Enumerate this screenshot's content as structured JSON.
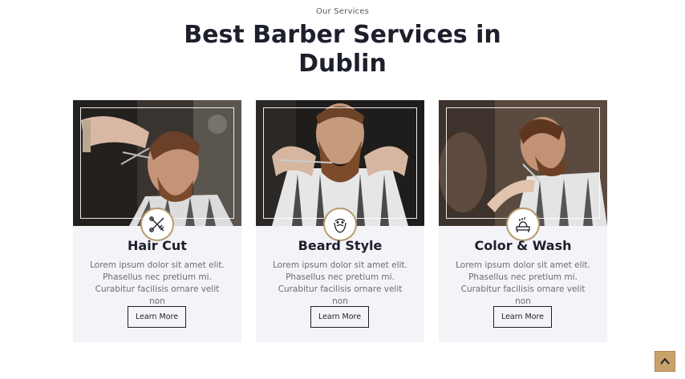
{
  "header": {
    "eyebrow": "Our Services",
    "title": "Best Barber Services in Dublin"
  },
  "services": [
    {
      "title": "Hair Cut",
      "description": "Lorem ipsum dolor sit amet elit. Phasellus nec pretium mi. Curabitur facilisis ornare velit non",
      "button_label": "Learn More",
      "icon": "scissors-comb-icon"
    },
    {
      "title": "Beard Style",
      "description": "Lorem ipsum dolor sit amet elit. Phasellus nec pretium mi. Curabitur facilisis ornare velit non",
      "button_label": "Learn More",
      "icon": "beard-face-icon"
    },
    {
      "title": "Color & Wash",
      "description": "Lorem ipsum dolor sit amet elit. Phasellus nec pretium mi. Curabitur facilisis ornare velit non",
      "button_label": "Learn More",
      "icon": "hair-wash-icon"
    }
  ],
  "scroll_top": {
    "icon": "chevron-up-icon"
  },
  "colors": {
    "accent": "#c9a26b",
    "heading": "#1d1f2c",
    "card_bg": "#f4f3f7",
    "body_text": "#6a6d76"
  }
}
